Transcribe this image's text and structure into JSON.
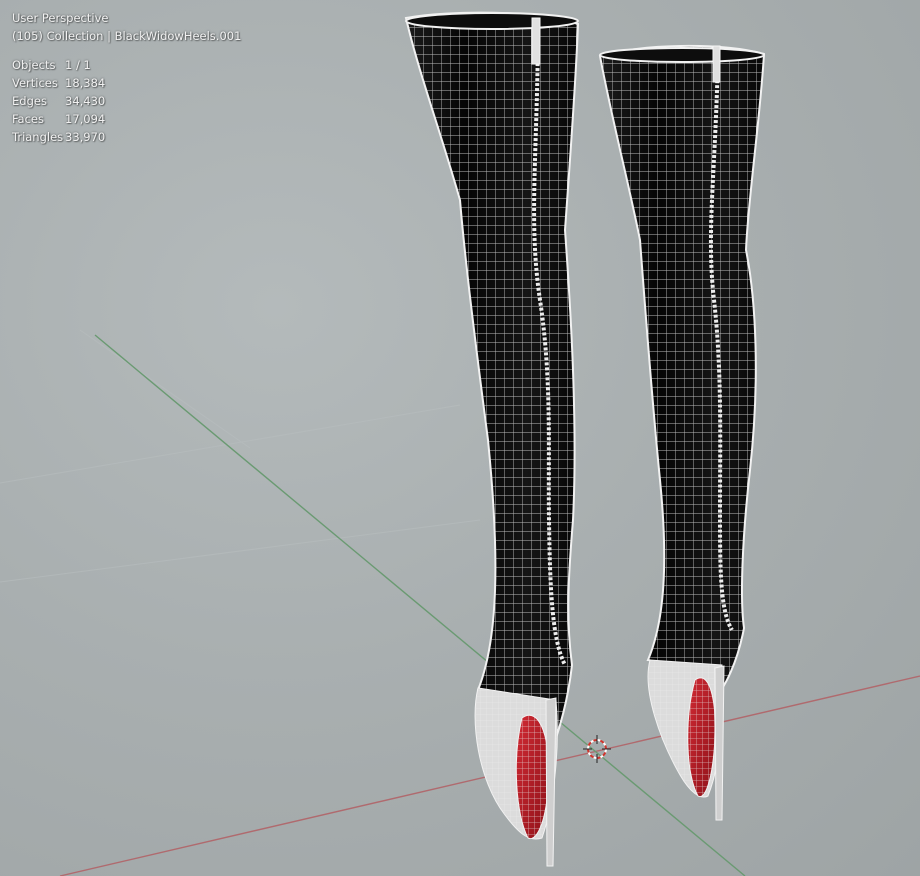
{
  "overlay": {
    "view_name": "User Perspective",
    "collection_line": "(105) Collection | BlackWidowHeels.001",
    "stats": [
      {
        "label": "Objects",
        "value": "1 / 1"
      },
      {
        "label": "Vertices",
        "value": "18,384"
      },
      {
        "label": "Edges",
        "value": "34,430"
      },
      {
        "label": "Faces",
        "value": "17,094"
      },
      {
        "label": "Triangles",
        "value": "33,970"
      }
    ]
  },
  "colors": {
    "background": "#a9afb0",
    "x_axis": "#b06a6e",
    "y_axis": "#6a9a72",
    "mesh_fill": "#0b0b0b",
    "wireframe": "#e9e9e9",
    "sole": "#b4202a"
  },
  "icons": {
    "cursor": "3d-cursor-icon"
  }
}
